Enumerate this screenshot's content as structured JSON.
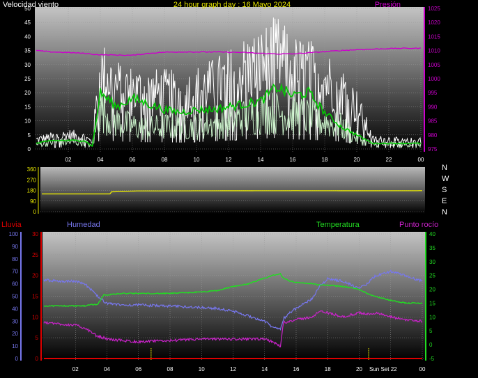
{
  "header": {
    "left_label": "Velocidad viento",
    "title": "24 hour graph day : 16 Mayo 2024",
    "right_label": "Presión"
  },
  "bottom_header": {
    "rain_label": "Lluvia",
    "humidity_label": "Humedad",
    "temperature_label": "Temperatura",
    "dewpoint_label": "Punto rocío"
  },
  "compass": [
    "N",
    "W",
    "S",
    "E",
    "N"
  ],
  "sunset_label": "Sun Set 22",
  "colors": {
    "wind_gust": "#ffffff",
    "wind_avg": "#c8f0c8",
    "wind_mean": "#00cc00",
    "pressure": "#cc00cc",
    "direction": "#e6e600",
    "humidity": "#7777ee",
    "temperature": "#22dd22",
    "dewpoint": "#cc22cc",
    "rain": "#dd0000",
    "sun_marker": "#e6e600"
  },
  "chart_data": [
    {
      "type": "line",
      "name": "wind_pressure",
      "x_tick_labels": [
        "02",
        "04",
        "06",
        "08",
        "10",
        "12",
        "14",
        "16",
        "18",
        "20",
        "22",
        "00"
      ],
      "y_left_ticks": [
        "0",
        "5",
        "10",
        "15",
        "20",
        "25",
        "30",
        "35",
        "40",
        "45",
        "50"
      ],
      "y_right_ticks": [
        "975",
        "980",
        "985",
        "990",
        "995",
        "1000",
        "1005",
        "1010",
        "1015",
        "1020",
        "1025"
      ],
      "ylim_left": [
        0,
        50
      ],
      "ylim_right": [
        975,
        1025
      ],
      "xlim": [
        0,
        24
      ],
      "x": [
        0,
        1,
        2,
        3,
        3.5,
        4,
        5,
        6,
        7,
        8,
        9,
        10,
        11,
        12,
        13,
        14,
        15,
        16,
        17,
        18,
        19,
        20,
        21,
        22,
        23,
        24
      ],
      "series": [
        {
          "key": "gust",
          "values": [
            4,
            5,
            6,
            5,
            3,
            33,
            27,
            25,
            24,
            24,
            23,
            25,
            27,
            30,
            34,
            36,
            40,
            34,
            33,
            30,
            26,
            18,
            4,
            4,
            3,
            4
          ]
        },
        {
          "key": "average",
          "values": [
            2,
            3,
            3,
            3,
            1,
            18,
            12,
            10,
            9,
            10,
            10,
            10,
            11,
            12,
            14,
            16,
            16,
            15,
            14,
            12,
            10,
            5,
            2,
            2,
            2,
            2
          ]
        },
        {
          "key": "mean",
          "values": [
            2,
            3,
            3,
            3,
            1,
            20,
            15,
            18,
            16,
            14,
            13,
            14,
            14,
            15,
            16,
            17,
            22,
            19,
            20,
            13,
            8,
            5,
            2,
            2,
            2,
            2
          ]
        },
        {
          "key": "pressure",
          "values": [
            1010,
            1009.5,
            1009.3,
            1009,
            1008.7,
            1008.5,
            1008.4,
            1008.3,
            1009,
            1009.4,
            1009.5,
            1009.5,
            1009.5,
            1009.4,
            1009.3,
            1009,
            1008.8,
            1008.8,
            1009.2,
            1009.6,
            1010,
            1010.3,
            1010.5,
            1010.7,
            1010.8,
            1010.8
          ]
        }
      ]
    },
    {
      "type": "line",
      "name": "wind_direction",
      "y_ticks": [
        "0",
        "90",
        "180",
        "270",
        "360"
      ],
      "ylim": [
        0,
        360
      ],
      "xlim": [
        0,
        24
      ],
      "x": [
        0,
        4.3,
        4.35,
        6,
        12,
        16,
        20,
        24
      ],
      "values": [
        150,
        150,
        168,
        175,
        177,
        178,
        177,
        178
      ]
    },
    {
      "type": "line",
      "name": "humidity_temperature",
      "x_tick_labels": [
        "02",
        "04",
        "06",
        "08",
        "10",
        "12",
        "14",
        "16",
        "18",
        "20",
        "22",
        "00"
      ],
      "y_left_ticks": [
        "0",
        "10",
        "20",
        "30",
        "40",
        "50",
        "60",
        "70",
        "80",
        "90",
        "100"
      ],
      "y_inner_ticks": [
        "0",
        "5",
        "10",
        "15",
        "20",
        "25",
        "30"
      ],
      "y_right_ticks": [
        "-5",
        "0",
        "5",
        "10",
        "15",
        "20",
        "25",
        "30",
        "35",
        "40"
      ],
      "ylim_humidity": [
        0,
        100
      ],
      "ylim_rain": [
        0,
        30
      ],
      "ylim_temp": [
        -5,
        40
      ],
      "xlim": [
        0,
        24
      ],
      "x": [
        0,
        1,
        2,
        2.6,
        3,
        3.4,
        3.8,
        4,
        5,
        6,
        8,
        10,
        11,
        12,
        13,
        14,
        14.5,
        15,
        15.2,
        15.6,
        16,
        17,
        17.5,
        18,
        19,
        20,
        20.5,
        21,
        22,
        23,
        24
      ],
      "series": [
        {
          "key": "humidity",
          "values": [
            63,
            62,
            62,
            60,
            55,
            50,
            46,
            44,
            43,
            43,
            42,
            41,
            40,
            38,
            34,
            30,
            25,
            24,
            32,
            37,
            40,
            48,
            58,
            64,
            62,
            56,
            60,
            66,
            70,
            66,
            62
          ]
        },
        {
          "key": "temperature",
          "values": [
            14,
            14,
            14,
            14,
            14.5,
            14.5,
            18,
            18,
            18.5,
            18.5,
            18.5,
            19,
            19.5,
            21,
            22,
            24,
            25,
            25.5,
            24,
            23,
            22.5,
            22,
            21.5,
            21.5,
            21,
            20,
            18.5,
            17.5,
            16,
            15,
            15
          ]
        },
        {
          "key": "dewpoint",
          "values": [
            8,
            7.5,
            7,
            6,
            4.5,
            3,
            2.5,
            2,
            1.5,
            1,
            1.5,
            2,
            2,
            2,
            2,
            2,
            1,
            -0.5,
            8,
            8.5,
            9,
            10,
            12,
            11.5,
            10,
            11.5,
            11,
            11.5,
            10,
            9,
            8.5
          ]
        },
        {
          "key": "rain",
          "values": [
            0,
            0,
            0,
            0,
            0,
            0,
            0,
            0,
            0,
            0,
            0,
            0,
            0,
            0,
            0,
            0,
            0,
            0,
            0,
            0,
            0,
            0,
            0,
            0,
            0,
            0,
            0,
            0,
            0,
            0,
            0
          ]
        }
      ],
      "sun_events_x": [
        6.8,
        20.6
      ]
    }
  ]
}
